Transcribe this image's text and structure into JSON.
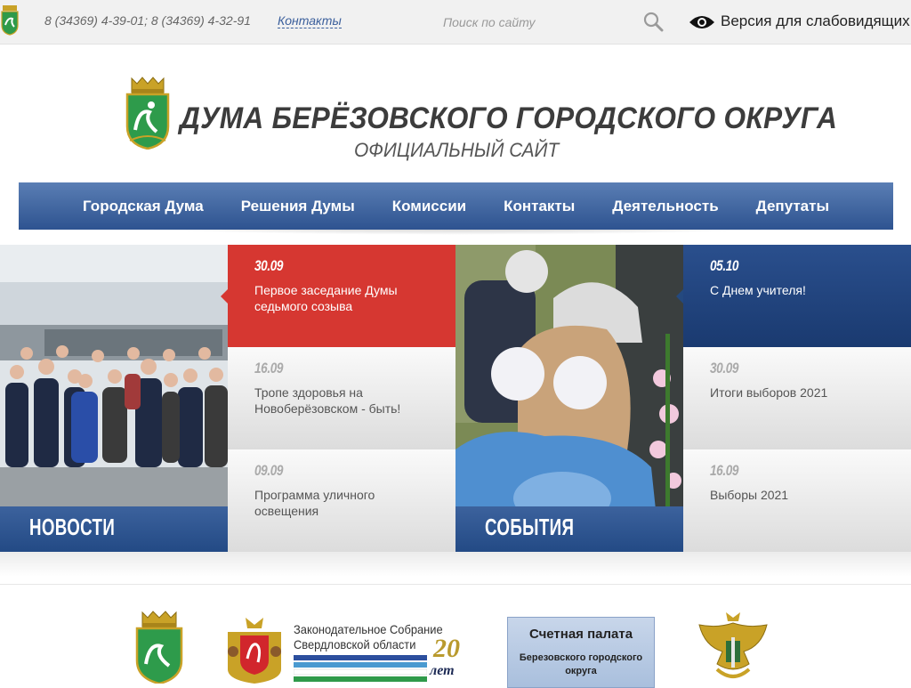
{
  "topbar": {
    "phones": "8 (34369) 4-39-01; 8 (34369) 4-32-91",
    "contacts_link": "Контакты",
    "search_placeholder": "Поиск по сайту",
    "vision_label": "Версия для слабовидящих"
  },
  "header": {
    "title": "ДУМА БЕРЁЗОВСКОГО ГОРОДСКОГО ОКРУГА",
    "subtitle": "ОФИЦИАЛЬНЫЙ САЙТ"
  },
  "nav": {
    "items": [
      "Городская Дума",
      "Решения Думы",
      "Комиссии",
      "Контакты",
      "Деятельность",
      "Депутаты"
    ]
  },
  "news": {
    "label": "НОВОСТИ",
    "items": [
      {
        "date": "30.09",
        "title": "Первое заседание Думы седьмого созыва"
      },
      {
        "date": "16.09",
        "title": "Тропе здоровья на Новоберёзовском - быть!"
      },
      {
        "date": "09.09",
        "title": "Программа уличного освещения"
      }
    ]
  },
  "events": {
    "label": "СОБЫТИЯ",
    "items": [
      {
        "date": "05.10",
        "title": "С Днем учителя!"
      },
      {
        "date": "30.09",
        "title": "Итоги выборов 2021"
      },
      {
        "date": "16.09",
        "title": "Выборы 2021"
      }
    ]
  },
  "partners": {
    "zs_title_line1": "Законодательное Собрание",
    "zs_title_line2": "Свердловской области",
    "zs_anniversary": "20",
    "zs_anniversary_word": "лет",
    "sp_title": "Счетная палата",
    "sp_line1": "Березовского городского",
    "sp_line2": "округа"
  },
  "colors": {
    "nav_blue": "#2e5390",
    "accent_red": "#d63731",
    "event_blue": "#1a3a70"
  },
  "icons": [
    "coat-of-arms-icon",
    "search-icon",
    "eye-icon",
    "sverdlovsk-emblem-icon",
    "double-eagle-emblem-icon"
  ]
}
